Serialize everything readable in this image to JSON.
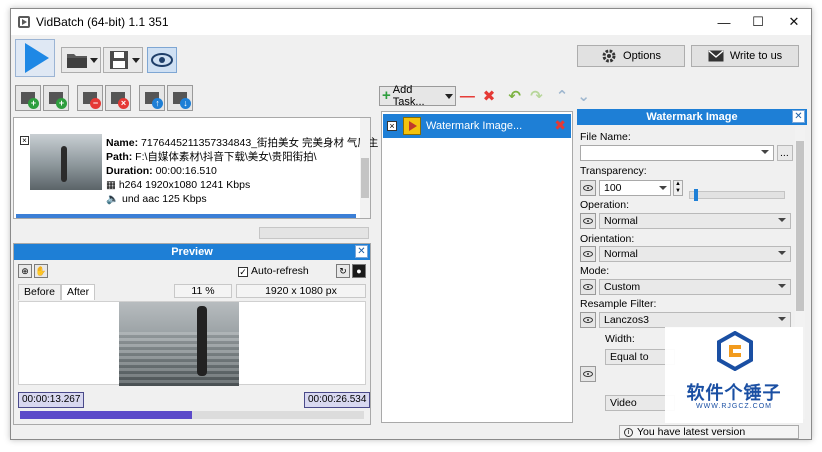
{
  "window": {
    "title": "VidBatch (64-bit) 1.1 351"
  },
  "toolbar": {
    "options_label": "Options",
    "write_label": "Write to us"
  },
  "file": {
    "name_label": "Name:",
    "name_value": "7176445211357334843_街拍美女 完美身材 气质主",
    "path_label": "Path:",
    "path_value": "F:\\自媒体素材\\抖音下载\\美女\\贵阳街拍\\",
    "duration_label": "Duration:",
    "duration_value": "00:00:16.510",
    "video_info": "h264 1920x1080 1241 Kbps",
    "audio_info": "und aac 125 Kbps"
  },
  "preview": {
    "title": "Preview",
    "autorefresh_label": "Auto-refresh",
    "tabs": [
      "Before",
      "After"
    ],
    "zoom": "11 %",
    "resolution": "1920 x 1080 px",
    "time_start": "00:00:13.267",
    "time_end": "00:00:26.534",
    "progress_fraction": 0.5
  },
  "tasks": {
    "add_label": "Add Task...",
    "items": [
      {
        "label": "Watermark Image..."
      }
    ]
  },
  "watermark": {
    "title": "Watermark Image",
    "file_label": "File Name:",
    "file_value": "",
    "browse_label": "...",
    "transparency_label": "Transparency:",
    "transparency_value": "100",
    "transparency_fraction": 0.04,
    "operation_label": "Operation:",
    "operation_value": "Normal",
    "orientation_label": "Orientation:",
    "orientation_value": "Normal",
    "mode_label": "Mode:",
    "mode_value": "Custom",
    "resample_label": "Resample Filter:",
    "resample_value": "Lanczos3",
    "width_label": "Width:",
    "width_value": "Equal to",
    "size_source_value": "Video"
  },
  "logo": {
    "text": "软件个锤子",
    "sub": "WWW.RJGCZ.COM"
  },
  "status": {
    "text": "You have latest version"
  },
  "colors": {
    "accent": "#1e7fd6",
    "play": "#1e88e5",
    "progress": "#5b49c9",
    "delete": "#e53935",
    "add": "#2e9e3e"
  }
}
